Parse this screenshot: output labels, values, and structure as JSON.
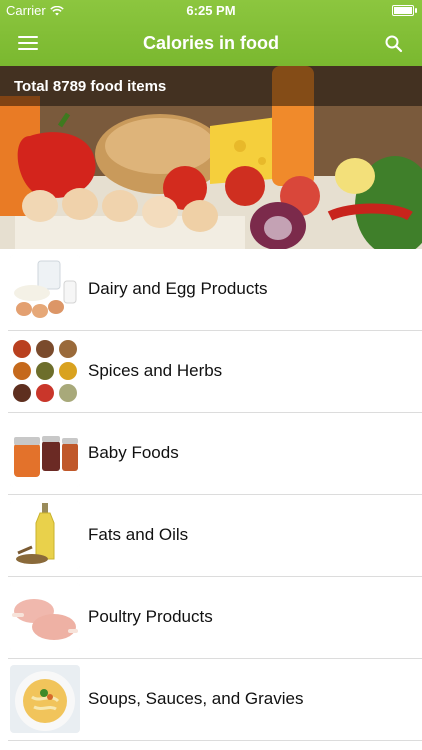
{
  "status": {
    "carrier": "Carrier",
    "time": "6:25 PM"
  },
  "nav": {
    "title": "Calories in food"
  },
  "hero": {
    "total_text": "Total 8789 food items"
  },
  "categories": [
    {
      "label": "Dairy and Egg Products",
      "icon": "dairy-eggs-icon"
    },
    {
      "label": "Spices and Herbs",
      "icon": "spices-icon"
    },
    {
      "label": "Baby Foods",
      "icon": "baby-food-jars-icon"
    },
    {
      "label": "Fats and Oils",
      "icon": "oil-bottle-icon"
    },
    {
      "label": "Poultry Products",
      "icon": "chicken-legs-icon"
    },
    {
      "label": "Soups, Sauces, and Gravies",
      "icon": "soup-bowl-icon"
    }
  ],
  "colors": {
    "accent": "#8cc63f",
    "separator": "#dcdcdc"
  }
}
